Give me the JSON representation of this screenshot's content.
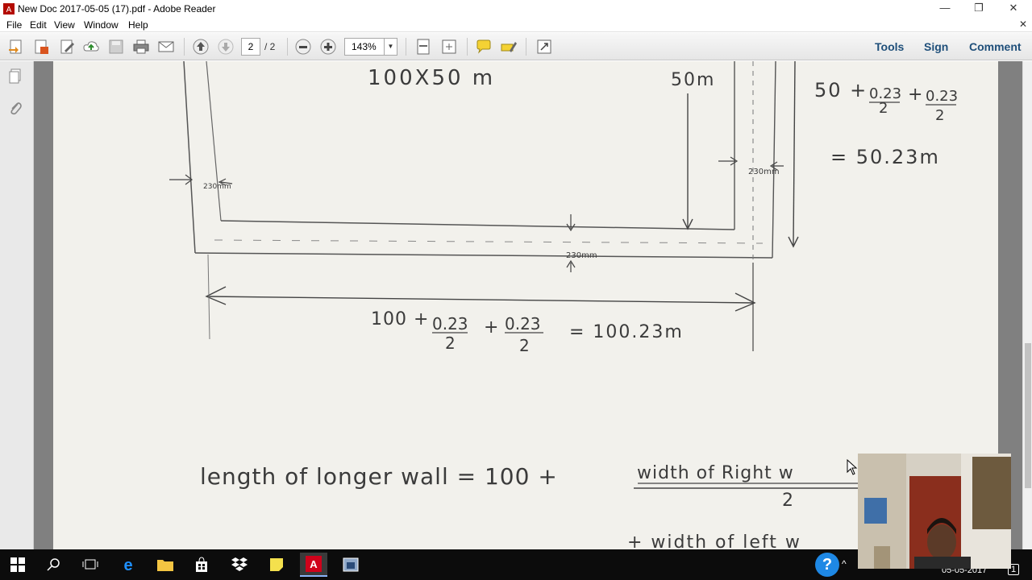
{
  "window": {
    "title": "New Doc 2017-05-05 (17).pdf - Adobe Reader",
    "minimize": "—",
    "restore": "❐",
    "close": "✕"
  },
  "menu": {
    "items": [
      "File",
      "Edit",
      "View",
      "Window",
      "Help"
    ],
    "close_doc": "✕"
  },
  "toolbar": {
    "page_current": "2",
    "page_total": "/ 2",
    "zoom": "143%",
    "tools_label": "Tools",
    "sign_label": "Sign",
    "comment_label": "Comment"
  },
  "drawing": {
    "dims_text": "100X50 m",
    "side_label": "50m",
    "right_calc_top": "50 +",
    "right_frac_num": "0.23",
    "right_frac_den": "2",
    "right_plus": "+",
    "right_result": "= 50.23m",
    "wall_thick_right": "230mm",
    "wall_thick_left": "230mm",
    "wall_thick_bottom": "230mm",
    "bottom_calc_start": "100 +",
    "bottom_frac_num": "0.23",
    "bottom_frac_den": "2",
    "bottom_plus": "+",
    "bottom_result": "= 100.23m",
    "length_line_text": "length of longer wall = 100 +",
    "length_frac_num": "width of Right w",
    "length_frac_den": "2",
    "next_line": "+ width of left w"
  },
  "taskbar": {
    "date": "05-05-2017",
    "notification_count": "1",
    "help_glyph": "?"
  }
}
